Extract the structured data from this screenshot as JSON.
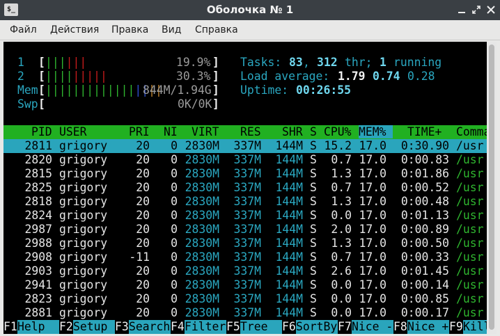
{
  "window": {
    "title": "Оболочка № 1",
    "icon_label": "$_",
    "buttons": [
      "minimize-icon",
      "maximize-icon",
      "close-icon"
    ]
  },
  "menu": [
    "Файл",
    "Действия",
    "Правка",
    "Вид",
    "Справка"
  ],
  "meters": {
    "cpu1": {
      "num": "1",
      "percent": "19.9%",
      "value": 0.199
    },
    "cpu2": {
      "num": "2",
      "percent": "30.3%",
      "value": 0.303
    },
    "mem": {
      "label": "Mem",
      "text": "844M/1.94G",
      "value": 0.435
    },
    "swp": {
      "label": "Swp",
      "text": "0K/0K",
      "value": 0.0
    }
  },
  "stats": {
    "tasks_label": "Tasks:",
    "tasks": "83",
    "threads": "312",
    "thr_label": "thr;",
    "running": "1",
    "running_label": "running",
    "load_label": "Load average:",
    "load1": "1.79",
    "load5": "0.74",
    "load15": "0.28",
    "uptime_label": "Uptime:",
    "uptime": "00:26:55"
  },
  "columns": [
    "PID",
    "USER",
    "PRI",
    "NI",
    "VIRT",
    "RES",
    "SHR",
    "S",
    "CPU%",
    "MEM%",
    "TIME+",
    "Command"
  ],
  "processes": [
    {
      "pid": "2811",
      "user": "grigory",
      "pri": "20",
      "ni": "0",
      "virt": "2830M",
      "res": "337M",
      "shr": "144M",
      "s": "S",
      "cpu": "15.2",
      "mem": "17.0",
      "time": "0:30.90",
      "cmd": "/usr"
    },
    {
      "pid": "2820",
      "user": "grigory",
      "pri": "20",
      "ni": "0",
      "virt": "2830M",
      "res": "337M",
      "shr": "144M",
      "s": "S",
      "cpu": "0.7",
      "mem": "17.0",
      "time": "0:00.83",
      "cmd": "/usr"
    },
    {
      "pid": "2815",
      "user": "grigory",
      "pri": "20",
      "ni": "0",
      "virt": "2830M",
      "res": "337M",
      "shr": "144M",
      "s": "S",
      "cpu": "1.3",
      "mem": "17.0",
      "time": "0:01.86",
      "cmd": "/usr"
    },
    {
      "pid": "2825",
      "user": "grigory",
      "pri": "20",
      "ni": "0",
      "virt": "2830M",
      "res": "337M",
      "shr": "144M",
      "s": "S",
      "cpu": "0.7",
      "mem": "17.0",
      "time": "0:00.52",
      "cmd": "/usr"
    },
    {
      "pid": "2818",
      "user": "grigory",
      "pri": "20",
      "ni": "0",
      "virt": "2830M",
      "res": "337M",
      "shr": "144M",
      "s": "S",
      "cpu": "1.3",
      "mem": "17.0",
      "time": "0:00.48",
      "cmd": "/usr"
    },
    {
      "pid": "2824",
      "user": "grigory",
      "pri": "20",
      "ni": "0",
      "virt": "2830M",
      "res": "337M",
      "shr": "144M",
      "s": "S",
      "cpu": "0.0",
      "mem": "17.0",
      "time": "0:01.13",
      "cmd": "/usr"
    },
    {
      "pid": "2987",
      "user": "grigory",
      "pri": "20",
      "ni": "0",
      "virt": "2830M",
      "res": "337M",
      "shr": "144M",
      "s": "S",
      "cpu": "2.0",
      "mem": "17.0",
      "time": "0:00.89",
      "cmd": "/usr"
    },
    {
      "pid": "2988",
      "user": "grigory",
      "pri": "20",
      "ni": "0",
      "virt": "2830M",
      "res": "337M",
      "shr": "144M",
      "s": "S",
      "cpu": "1.3",
      "mem": "17.0",
      "time": "0:00.50",
      "cmd": "/usr"
    },
    {
      "pid": "2908",
      "user": "grigory",
      "pri": "-11",
      "ni": "0",
      "virt": "2830M",
      "res": "337M",
      "shr": "144M",
      "s": "S",
      "cpu": "0.7",
      "mem": "17.0",
      "time": "0:00.33",
      "cmd": "/usr"
    },
    {
      "pid": "2903",
      "user": "grigory",
      "pri": "20",
      "ni": "0",
      "virt": "2830M",
      "res": "337M",
      "shr": "144M",
      "s": "S",
      "cpu": "2.6",
      "mem": "17.0",
      "time": "0:01.45",
      "cmd": "/usr"
    },
    {
      "pid": "2941",
      "user": "grigory",
      "pri": "20",
      "ni": "0",
      "virt": "2830M",
      "res": "337M",
      "shr": "144M",
      "s": "S",
      "cpu": "0.0",
      "mem": "17.0",
      "time": "0:00.14",
      "cmd": "/usr"
    },
    {
      "pid": "2823",
      "user": "grigory",
      "pri": "20",
      "ni": "0",
      "virt": "2830M",
      "res": "337M",
      "shr": "144M",
      "s": "S",
      "cpu": "0.0",
      "mem": "17.0",
      "time": "0:00.85",
      "cmd": "/usr"
    },
    {
      "pid": "2881",
      "user": "grigory",
      "pri": "20",
      "ni": "0",
      "virt": "2830M",
      "res": "337M",
      "shr": "144M",
      "s": "S",
      "cpu": "0.0",
      "mem": "17.0",
      "time": "0:00.17",
      "cmd": "/usr"
    }
  ],
  "selected_index": 0,
  "fkeys": [
    {
      "key": "F1",
      "label": "Help"
    },
    {
      "key": "F2",
      "label": "Setup"
    },
    {
      "key": "F3",
      "label": "Search"
    },
    {
      "key": "F4",
      "label": "Filter"
    },
    {
      "key": "F5",
      "label": "Tree"
    },
    {
      "key": "F6",
      "label": "SortBy"
    },
    {
      "key": "F7",
      "label": "Nice -"
    },
    {
      "key": "F8",
      "label": "Nice +"
    },
    {
      "key": "F9",
      "label": "Kill"
    }
  ],
  "colors": {
    "header_bg": "#21b021",
    "selected_bg": "#2aa5bc",
    "mem_sort_bg": "#2aa5bc"
  }
}
